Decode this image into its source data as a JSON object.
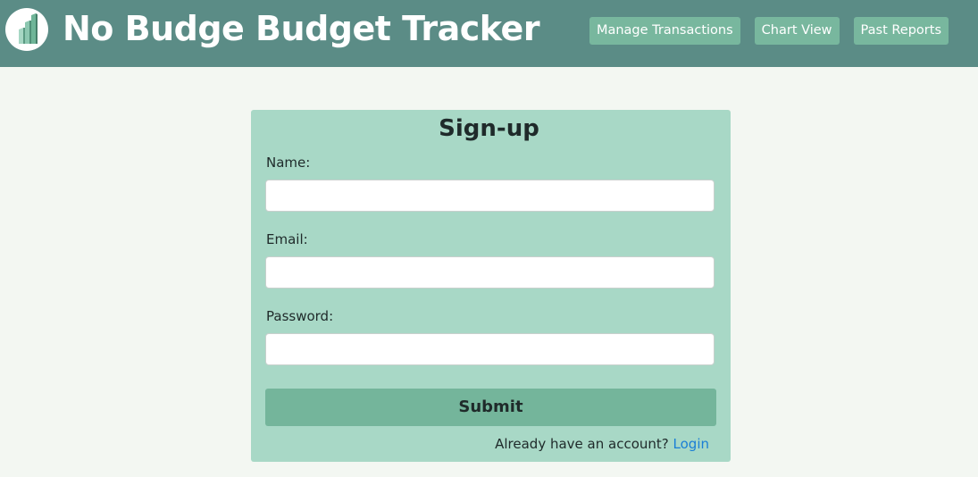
{
  "header": {
    "brand": "No Budge Budget Tracker",
    "logo_icon": "bar-chart-logo-icon",
    "nav": [
      {
        "label": "Manage Transactions"
      },
      {
        "label": "Chart View"
      },
      {
        "label": "Past Reports"
      }
    ]
  },
  "form": {
    "title": "Sign-up",
    "fields": [
      {
        "label": "Name:",
        "value": ""
      },
      {
        "label": "Email:",
        "value": ""
      },
      {
        "label": "Password:",
        "value": ""
      }
    ],
    "submit_label": "Submit",
    "account_prompt": "Already have an account?",
    "login_link": "Login"
  },
  "colors": {
    "header": "#5b8c86",
    "nav_button": "#78b79e",
    "card": "#a8d8c6",
    "submit": "#74b59b",
    "link": "#1a7fd6",
    "background": "#f3f7f2"
  }
}
